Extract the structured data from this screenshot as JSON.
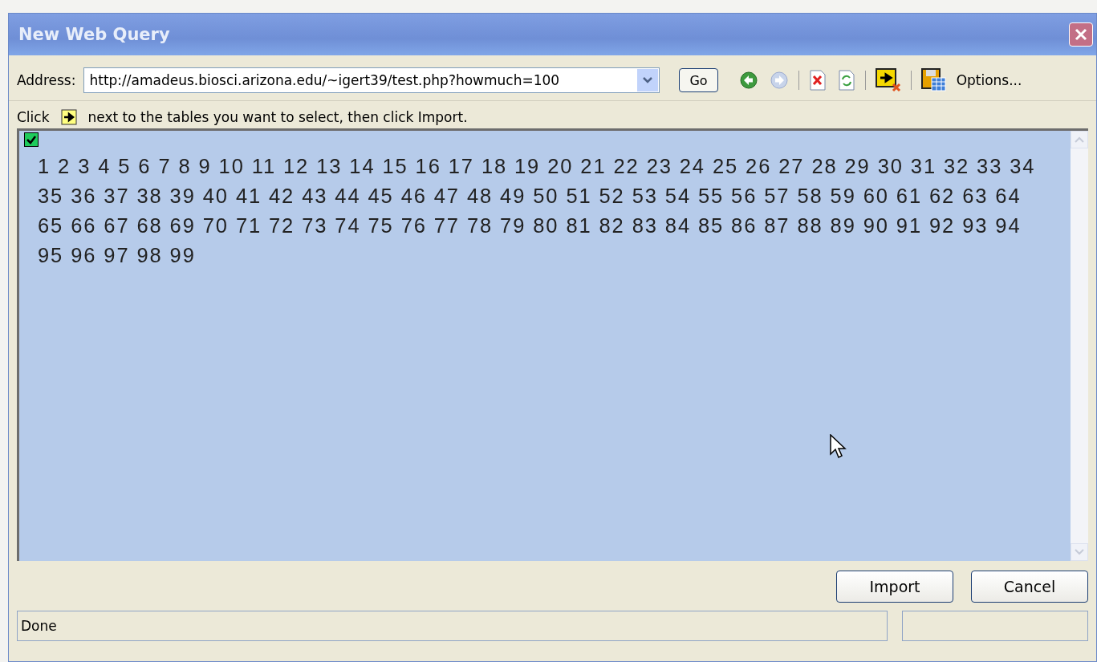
{
  "window": {
    "title": "New Web Query"
  },
  "address": {
    "label": "Address:",
    "value": "http://amadeus.biosci.arizona.edu/~igert39/test.php?howmuch=100"
  },
  "toolbar": {
    "go": "Go",
    "options": "Options..."
  },
  "instruction": {
    "before": "Click",
    "after": "next to the tables you want to select, then click Import."
  },
  "content": {
    "table_selected": true,
    "text": "1 2 3 4 5 6 7 8 9 10 11 12 13 14 15 16 17 18 19 20 21 22 23 24 25 26 27 28 29 30 31 32 33 34 35 36 37 38 39 40 41 42 43 44 45 46 47 48 49 50 51 52 53 54 55 56 57 58 59 60 61 62 63 64 65 66 67 68 69 70 71 72 73 74 75 76 77 78 79 80 81 82 83 84 85 86 87 88 89 90 91 92 93 94 95 96 97 98 99"
  },
  "buttons": [
    "Import",
    "Cancel"
  ],
  "status_bar": {
    "text": "Done"
  }
}
